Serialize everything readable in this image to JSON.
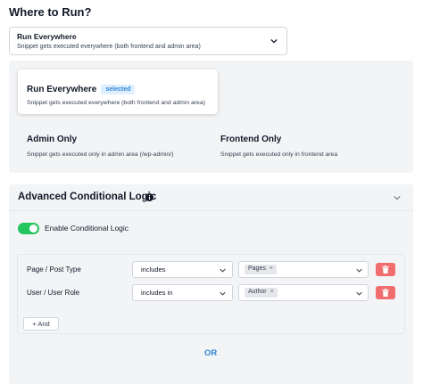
{
  "section_title": "Where to Run?",
  "dropdown": {
    "title": "Run Everywhere",
    "description": "Snippet gets executed everywhere (both frontend and admin area)"
  },
  "options": [
    {
      "title": "Run Everywhere",
      "badge": "selected",
      "description": "Snippet gets executed everywhere (both frontend and admin area)",
      "selected": true
    },
    {
      "title": "Admin Only",
      "description": "Snippet gets executed only in admin area (/wp-admin/)",
      "selected": false
    },
    {
      "title": "Frontend Only",
      "description": "Snippet gets executed only in frontend area",
      "selected": false
    }
  ],
  "advanced": {
    "title": "Advanced Conditional Logic",
    "toggle_label": "Enable Conditional Logic",
    "toggle_on": true,
    "rules": [
      {
        "label": "Page / Post Type",
        "operator": "includes",
        "values": [
          "Pages"
        ]
      },
      {
        "label": "User / User Role",
        "operator": "includes in",
        "values": [
          "Author"
        ]
      }
    ],
    "and_button": "+ And",
    "or_label": "OR"
  },
  "colors": {
    "accent": "#2f86d4",
    "toggle": "#22c55e",
    "delete": "#f26d6d",
    "panel_bg": "#f3f4f6"
  }
}
